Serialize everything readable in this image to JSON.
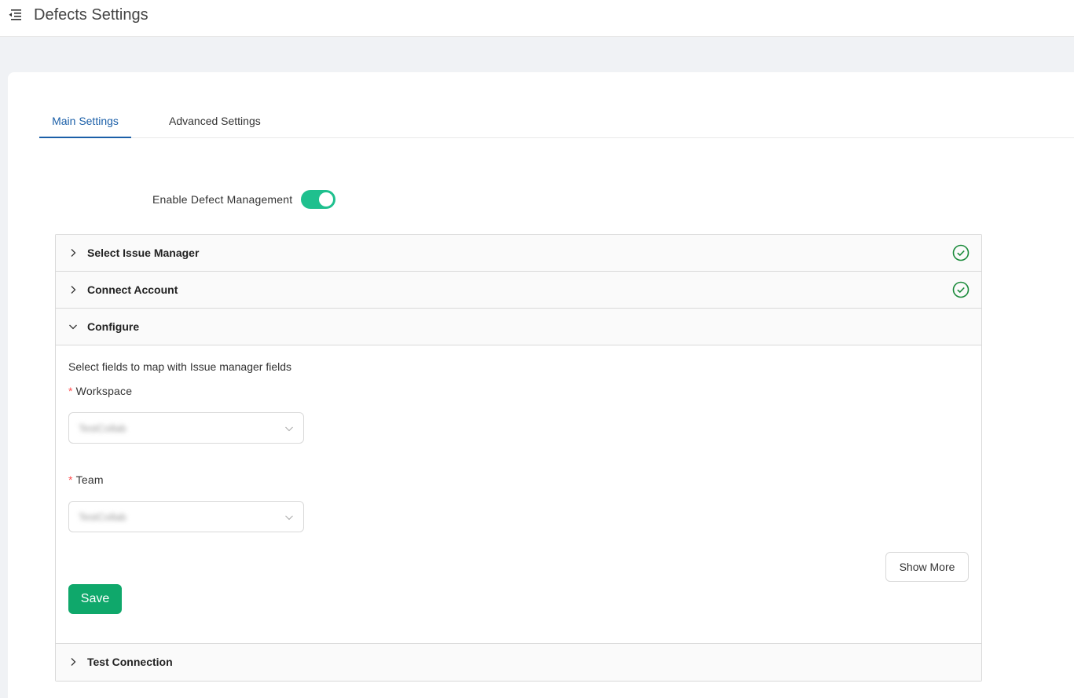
{
  "header": {
    "title": "Defects Settings",
    "menu_icon": "menu-fold-icon"
  },
  "tabs": [
    {
      "label": "Main Settings",
      "active": true
    },
    {
      "label": "Advanced Settings",
      "active": false
    }
  ],
  "toggle": {
    "label": "Enable Defect Management",
    "on": true,
    "color": "#1fc08e"
  },
  "panels": [
    {
      "title": "Select Issue Manager",
      "expanded": false,
      "complete": true
    },
    {
      "title": "Connect Account",
      "expanded": false,
      "complete": true
    },
    {
      "title": "Configure",
      "expanded": true,
      "complete": false
    },
    {
      "title": "Test Connection",
      "expanded": false,
      "complete": false
    }
  ],
  "configure": {
    "description": "Select fields to map with Issue manager fields",
    "required_mark": "*",
    "fields": [
      {
        "label": "Workspace",
        "value": "TestCollab"
      },
      {
        "label": "Team",
        "value": "TestCollab"
      }
    ],
    "show_more_label": "Show More",
    "save_label": "Save"
  },
  "colors": {
    "accent": "#1b5fa8",
    "success": "#0fa86b",
    "check": "#1a8a3a"
  }
}
